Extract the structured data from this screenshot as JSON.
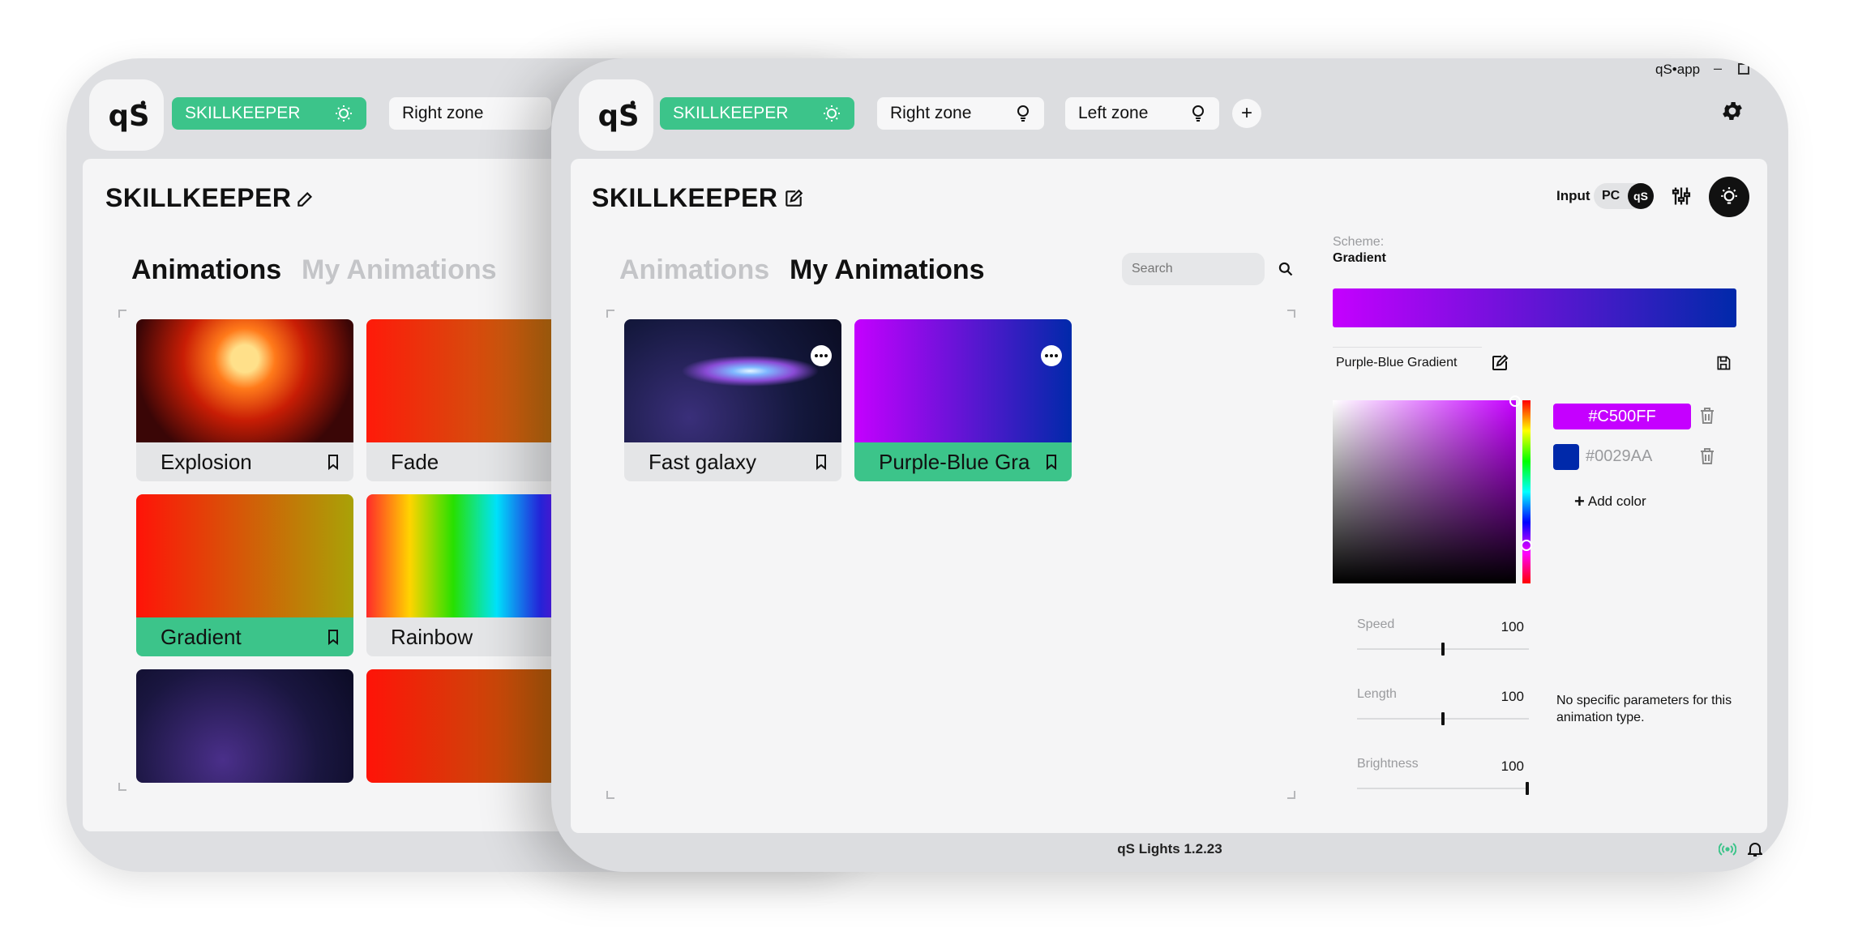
{
  "window": {
    "app_label": "qS•app",
    "minimize_glyph": "–",
    "maximize_glyph": "□"
  },
  "back": {
    "zones": [
      {
        "label": "SKILLKEEPER",
        "active": true
      },
      {
        "label": "Right zone",
        "active": false
      }
    ],
    "profile_title": "SKILLKEEPER",
    "tabs": [
      {
        "label": "Animations",
        "active": true
      },
      {
        "label": "My Animations",
        "active": false
      }
    ],
    "cards": [
      {
        "label": "Explosion",
        "selected": false
      },
      {
        "label": "Fade",
        "selected": false
      },
      {
        "label": "Gradient",
        "selected": true
      },
      {
        "label": "Rainbow",
        "selected": false
      }
    ]
  },
  "front": {
    "zones": [
      {
        "label": "SKILLKEEPER",
        "active": true
      },
      {
        "label": "Right zone",
        "active": false
      },
      {
        "label": "Left zone",
        "active": false
      }
    ],
    "add_zone_glyph": "+",
    "profile_title": "SKILLKEEPER",
    "input_label": "Input",
    "input_source": "PC",
    "tabs": [
      {
        "label": "Animations",
        "active": false
      },
      {
        "label": "My Animations",
        "active": true
      }
    ],
    "search": {
      "placeholder": "Search",
      "value": ""
    },
    "cards": [
      {
        "label": "Fast galaxy",
        "selected": false
      },
      {
        "label": "Purple-Blue Gra",
        "selected": true
      }
    ],
    "scheme": {
      "label": "Scheme:",
      "value": "Gradient"
    },
    "gradient_name": "Purple-Blue Gradient",
    "colors": [
      {
        "hex": "#C500FF",
        "active": true
      },
      {
        "hex": "#0029AA",
        "active": false
      }
    ],
    "add_color_label": "Add color",
    "add_color_glyph": "+",
    "sliders": [
      {
        "label": "Speed",
        "value": "100",
        "level": 0.5
      },
      {
        "label": "Length",
        "value": "100",
        "level": 0.5
      },
      {
        "label": "Brightness",
        "value": "100",
        "level": 1.0
      }
    ],
    "no_params_text": "No specific parameters for this animation type.",
    "footer_version": "qS Lights 1.2.23"
  },
  "colors": {
    "accent_green": "#3cc48a",
    "gradient_start": "#C500FF",
    "gradient_end": "#0029AA"
  },
  "icons": [
    "bulb-icon",
    "edit-icon",
    "bookmark-icon",
    "more-icon",
    "search-icon",
    "gear-icon",
    "sliders-icon",
    "save-icon",
    "trash-icon",
    "broadcast-icon",
    "bell-icon"
  ]
}
